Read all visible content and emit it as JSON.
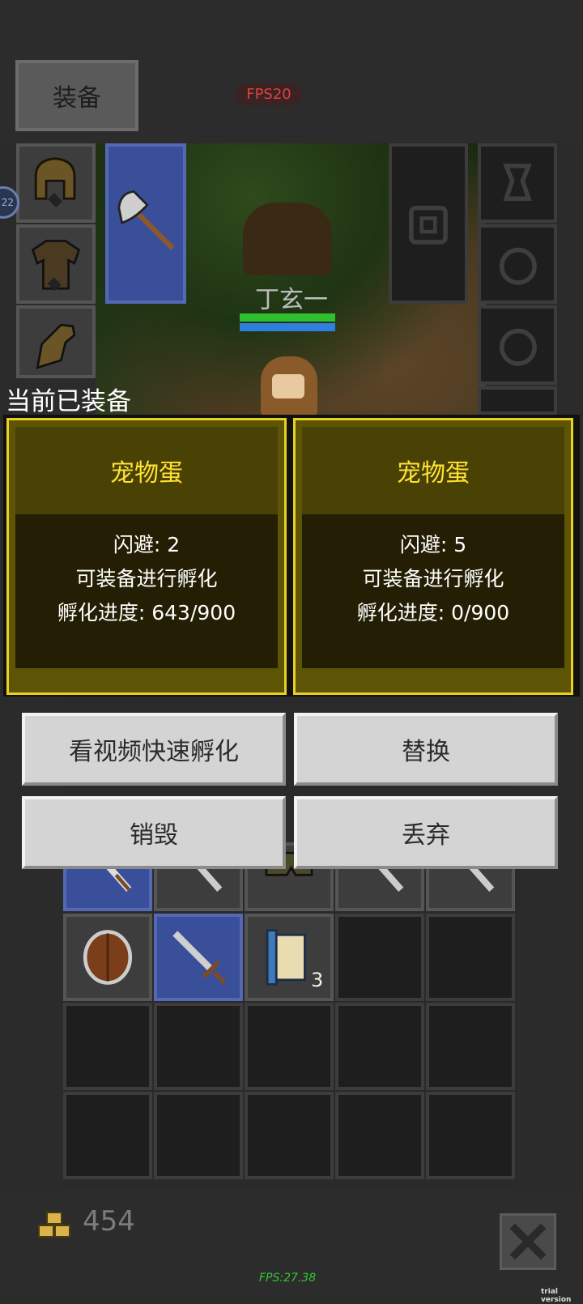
{
  "header": {
    "equip_tab_label": "装备",
    "fps_badge": "FPS20"
  },
  "side_badge": "22",
  "scene": {
    "character_name": "丁玄一"
  },
  "overlay": {
    "section_label": "当前已装备",
    "cards": [
      {
        "title": "宠物蛋",
        "lines": [
          "闪避: 2",
          "可装备进行孵化",
          "孵化进度: 643/900"
        ],
        "hatch_progress": 0.714
      },
      {
        "title": "宠物蛋",
        "lines": [
          "闪避: 5",
          "可装备进行孵化",
          "孵化进度: 0/900"
        ],
        "hatch_progress": 0.0
      }
    ],
    "buttons": {
      "watch_video": "看视频快速孵化",
      "replace": "替换",
      "destroy": "销毁",
      "discard": "丢弃"
    }
  },
  "inventory": {
    "scroll_count": "3"
  },
  "footer": {
    "gold": "454",
    "fps_text": "FPS:27.38",
    "trial_text": "trial version"
  },
  "colors": {
    "card_border": "#e8d21f",
    "card_title": "#ffe233",
    "button_bg": "#d4d4d4",
    "fps_red": "#e04040"
  }
}
